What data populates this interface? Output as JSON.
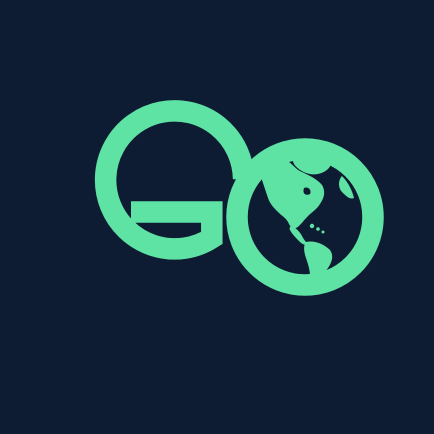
{
  "app": {
    "logo_text": "GO"
  },
  "colors": {
    "background": "#0e1c33",
    "accent": "#5fe3a4",
    "ocean": "#0e1c33"
  },
  "icons": {
    "logo": "go-globe-logo",
    "globe": "globe-americas-icon"
  }
}
